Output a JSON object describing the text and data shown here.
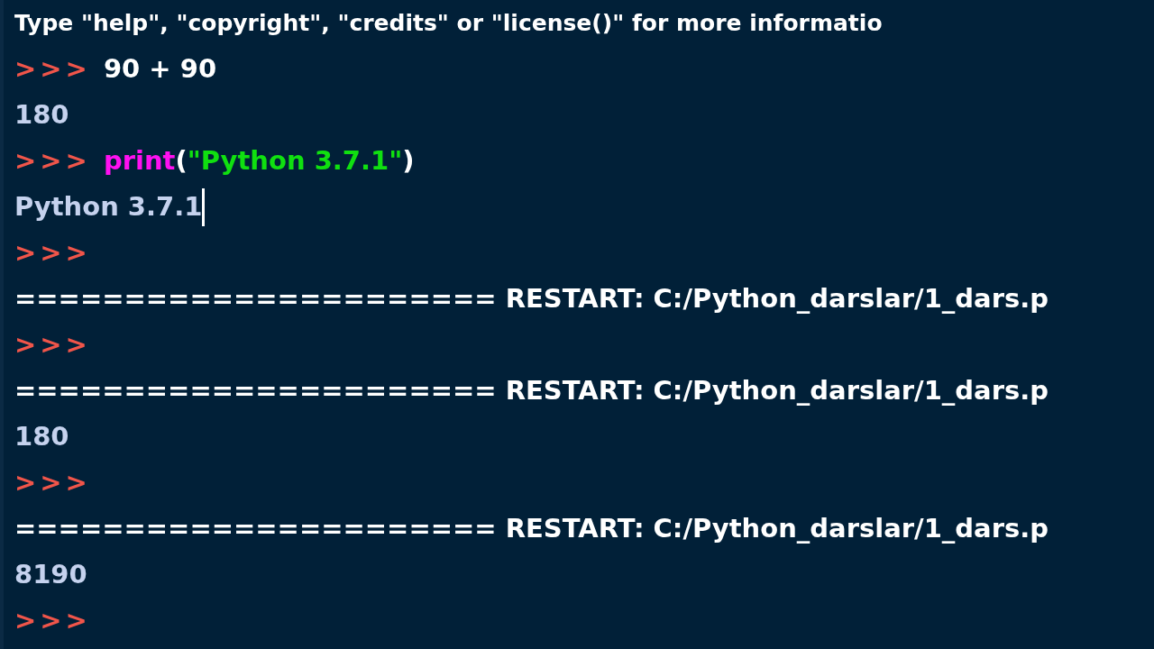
{
  "lines": [
    {
      "cursor": false,
      "segments": [
        {
          "kind": "output",
          "text": "Type \"help\", \"copyright\", \"credits\" or \"license()\" for more informatio"
        }
      ]
    },
    {
      "cursor": false,
      "segments": [
        {
          "kind": "prompt",
          "text": ">>>"
        },
        {
          "kind": "code",
          "text": "90 + 90"
        }
      ]
    },
    {
      "cursor": false,
      "segments": [
        {
          "kind": "result",
          "text": "180"
        }
      ]
    },
    {
      "cursor": false,
      "segments": [
        {
          "kind": "prompt",
          "text": ">>>"
        },
        {
          "kind": "builtin",
          "text": "print"
        },
        {
          "kind": "code",
          "text": "("
        },
        {
          "kind": "string",
          "text": "\"Python 3.7.1\""
        },
        {
          "kind": "code",
          "text": ")"
        }
      ]
    },
    {
      "cursor": true,
      "segments": [
        {
          "kind": "result",
          "text": "Python 3.7.1"
        }
      ]
    },
    {
      "cursor": false,
      "segments": [
        {
          "kind": "prompt",
          "text": ">>>"
        }
      ]
    },
    {
      "cursor": false,
      "segments": [
        {
          "kind": "code",
          "text": "====================== RESTART: C:/Python_darslar/1_dars.p"
        }
      ]
    },
    {
      "cursor": false,
      "segments": [
        {
          "kind": "prompt",
          "text": ">>>"
        }
      ]
    },
    {
      "cursor": false,
      "segments": [
        {
          "kind": "code",
          "text": "====================== RESTART: C:/Python_darslar/1_dars.p"
        }
      ]
    },
    {
      "cursor": false,
      "segments": [
        {
          "kind": "result",
          "text": "180"
        }
      ]
    },
    {
      "cursor": false,
      "segments": [
        {
          "kind": "prompt",
          "text": ">>>"
        }
      ]
    },
    {
      "cursor": false,
      "segments": [
        {
          "kind": "code",
          "text": "====================== RESTART: C:/Python_darslar/1_dars.p"
        }
      ]
    },
    {
      "cursor": false,
      "segments": [
        {
          "kind": "result",
          "text": "8190"
        }
      ]
    },
    {
      "cursor": false,
      "segments": [
        {
          "kind": "prompt",
          "text": ">>>"
        }
      ]
    }
  ]
}
